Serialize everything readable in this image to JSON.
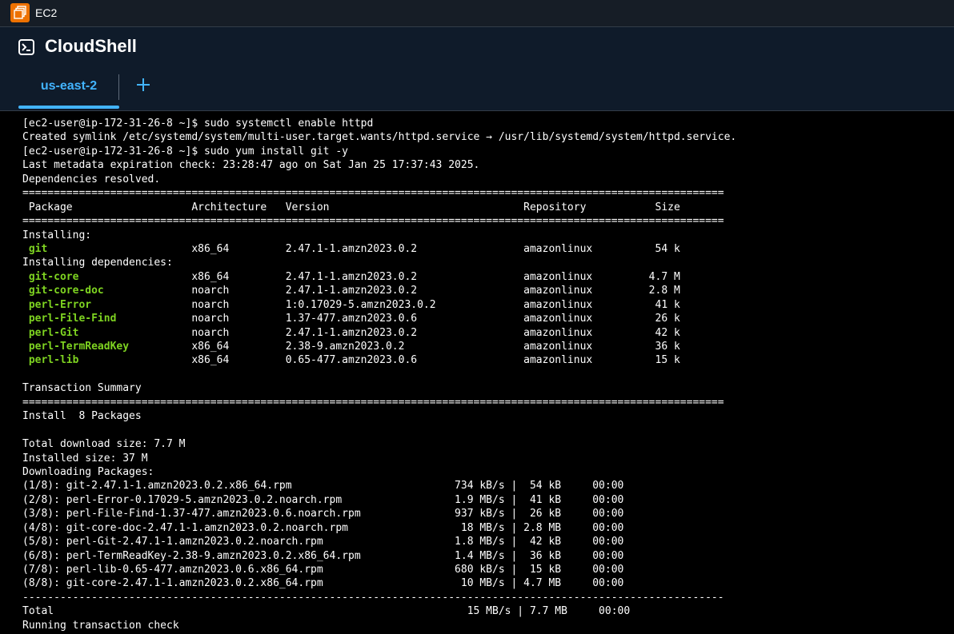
{
  "topbar": {
    "service_name": "EC2",
    "service_icon": "ec2-service-icon",
    "accent": "#ed7100"
  },
  "header": {
    "icon": "terminal-icon",
    "title": "CloudShell"
  },
  "tabs": {
    "active_label": "us-east-2",
    "active_color": "#42b4ff",
    "add_icon": "plus-icon"
  },
  "terminal": {
    "text_color": "#ffffff",
    "package_color": "#7ed321",
    "lines": [
      "[ec2-user@ip-172-31-26-8 ~]$ sudo systemctl enable httpd",
      "Created symlink /etc/systemd/system/multi-user.target.wants/httpd.service → /usr/lib/systemd/system/httpd.service.",
      "[ec2-user@ip-172-31-26-8 ~]$ sudo yum install git -y",
      "Last metadata expiration check: 23:28:47 ago on Sat Jan 25 17:37:43 2025.",
      "Dependencies resolved.",
      "================================================================================================================",
      " Package                   Architecture   Version                               Repository           Size",
      "================================================================================================================",
      "Installing:",
      " git                       x86_64         2.47.1-1.amzn2023.0.2                 amazonlinux          54 k",
      "Installing dependencies:",
      " git-core                  x86_64         2.47.1-1.amzn2023.0.2                 amazonlinux         4.7 M",
      " git-core-doc              noarch         2.47.1-1.amzn2023.0.2                 amazonlinux         2.8 M",
      " perl-Error                noarch         1:0.17029-5.amzn2023.0.2              amazonlinux          41 k",
      " perl-File-Find            noarch         1.37-477.amzn2023.0.6                 amazonlinux          26 k",
      " perl-Git                  noarch         2.47.1-1.amzn2023.0.2                 amazonlinux          42 k",
      " perl-TermReadKey          x86_64         2.38-9.amzn2023.0.2                   amazonlinux          36 k",
      " perl-lib                  x86_64         0.65-477.amzn2023.0.6                 amazonlinux          15 k",
      "",
      "Transaction Summary",
      "================================================================================================================",
      "Install  8 Packages",
      "",
      "Total download size: 7.7 M",
      "Installed size: 37 M",
      "Downloading Packages:",
      "(1/8): git-2.47.1-1.amzn2023.0.2.x86_64.rpm                          734 kB/s |  54 kB     00:00",
      "(2/8): perl-Error-0.17029-5.amzn2023.0.2.noarch.rpm                  1.9 MB/s |  41 kB     00:00",
      "(3/8): perl-File-Find-1.37-477.amzn2023.0.6.noarch.rpm               937 kB/s |  26 kB     00:00",
      "(4/8): git-core-doc-2.47.1-1.amzn2023.0.2.noarch.rpm                  18 MB/s | 2.8 MB     00:00",
      "(5/8): perl-Git-2.47.1-1.amzn2023.0.2.noarch.rpm                     1.8 MB/s |  42 kB     00:00",
      "(6/8): perl-TermReadKey-2.38-9.amzn2023.0.2.x86_64.rpm               1.4 MB/s |  36 kB     00:00",
      "(7/8): perl-lib-0.65-477.amzn2023.0.6.x86_64.rpm                     680 kB/s |  15 kB     00:00",
      "(8/8): git-core-2.47.1-1.amzn2023.0.2.x86_64.rpm                      10 MB/s | 4.7 MB     00:00",
      "----------------------------------------------------------------------------------------------------------------",
      "Total                                                                  15 MB/s | 7.7 MB     00:00",
      "Running transaction check"
    ]
  }
}
